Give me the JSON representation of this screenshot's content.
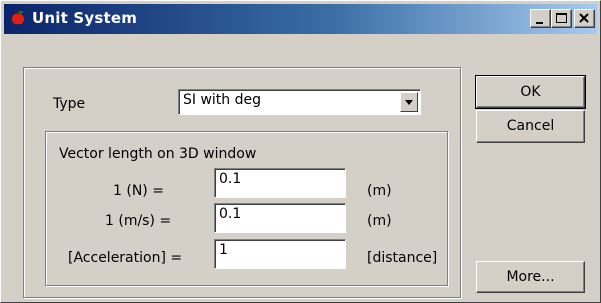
{
  "window": {
    "title": "Unit System"
  },
  "main": {
    "type_label": "Type",
    "type_value": "SI with deg",
    "vector_group_label": "Vector length on 3D window",
    "rows": [
      {
        "label": "1 (N) =",
        "value": "0.1",
        "unit": "(m)"
      },
      {
        "label": "1 (m/s) =",
        "value": "0.1",
        "unit": "(m)"
      },
      {
        "label": "[Acceleration] =",
        "value": "1",
        "unit": "[distance]"
      }
    ]
  },
  "buttons": {
    "ok": "OK",
    "cancel": "Cancel",
    "more": "More..."
  }
}
